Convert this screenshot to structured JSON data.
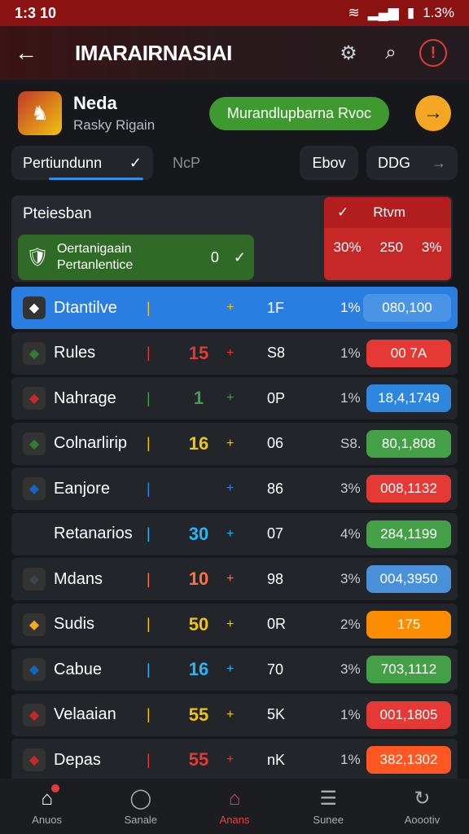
{
  "status": {
    "time": "1:3 10",
    "battery": "1.3%"
  },
  "appbar": {
    "title": "IMARAIRNASIAI",
    "back_icon": "arrow-left-icon",
    "settings_icon": "gear-icon",
    "search_icon": "search-icon",
    "alert_icon": "alert-icon"
  },
  "team": {
    "name": "Neda",
    "subtitle": "Rasky Rigain",
    "action_label": "Murandlupbarna Rvoc"
  },
  "tabs": [
    {
      "label": "Pertiundunn",
      "active": true
    },
    {
      "label": "NcP",
      "active": false
    },
    {
      "label": "Ebov",
      "active": false
    },
    {
      "label": "DDG",
      "active": false
    }
  ],
  "summary": {
    "label": "Pteiesban",
    "green_line1": "Oertanigaain",
    "green_line2": "Pertanlentice",
    "green_value": "0",
    "red_header": "Rtvm",
    "red_values": [
      "30%",
      "250",
      "3%"
    ]
  },
  "rows": [
    {
      "name": "Dtantilve",
      "score": "",
      "mid": "1F",
      "pct": "1%",
      "pill": "080,100",
      "score_color": "#f1c40f",
      "pill_color": "#4a94e6",
      "highlight": true,
      "icon_color": "#ffffff"
    },
    {
      "name": "Rules",
      "score": "15",
      "mid": "S8",
      "pct": "1%",
      "pill": "00  7A",
      "score_color": "#e53935",
      "pill_color": "#e53935",
      "highlight": false,
      "icon_color": "#2e7d32"
    },
    {
      "name": "Nahrage",
      "score": "1",
      "mid": "0P",
      "pct": "1%",
      "pill": "18,4,1749",
      "score_color": "#43a047",
      "pill_color": "#2e86de",
      "highlight": false,
      "icon_color": "#c62828"
    },
    {
      "name": "Colnarlirip",
      "score": "16",
      "mid": "06",
      "pct": "S8.",
      "pill": "80,1,808",
      "score_color": "#f1c40f",
      "pill_color": "#43a047",
      "highlight": false,
      "icon_color": "#2e7d32"
    },
    {
      "name": "Eanjore",
      "score": "",
      "mid": "86",
      "pct": "3%",
      "pill": "008,1132",
      "score_color": "#2e86de",
      "pill_color": "#e53935",
      "highlight": false,
      "icon_color": "#1565c0"
    },
    {
      "name": "Retanarios",
      "score": "30",
      "mid": "07",
      "pct": "4%",
      "pill": "284,1199",
      "score_color": "#29b6f6",
      "pill_color": "#43a047",
      "highlight": false,
      "icon_color": ""
    },
    {
      "name": "Mdans",
      "score": "10",
      "mid": "98",
      "pct": "3%",
      "pill": "004,3950",
      "score_color": "#ff7043",
      "pill_color": "#4a90d9",
      "highlight": false,
      "icon_color": "#37474f"
    },
    {
      "name": "Sudis",
      "score": "50",
      "mid": "0R",
      "pct": "2%",
      "pill": "175",
      "score_color": "#f1c40f",
      "pill_color": "#fb8c00",
      "highlight": false,
      "icon_color": "#f9a825"
    },
    {
      "name": "Cabue",
      "score": "16",
      "mid": "70",
      "pct": "3%",
      "pill": "703,1112",
      "score_color": "#29b6f6",
      "pill_color": "#43a047",
      "highlight": false,
      "icon_color": "#1565c0"
    },
    {
      "name": "Velaaian",
      "score": "55",
      "mid": "5K",
      "pct": "1%",
      "pill": "001,1805",
      "score_color": "#f1c40f",
      "pill_color": "#e53935",
      "highlight": false,
      "icon_color": "#c62828"
    },
    {
      "name": "Depas",
      "score": "55",
      "mid": "nK",
      "pct": "1%",
      "pill": "382,1302",
      "score_color": "#e53935",
      "pill_color": "#ff5722",
      "highlight": false,
      "icon_color": "#c62828"
    }
  ],
  "nav": [
    {
      "label": "Anuos",
      "icon": "home-icon",
      "glyph": "⌂",
      "active": false
    },
    {
      "label": "Sanale",
      "icon": "chat-icon",
      "glyph": "◯",
      "active": false
    },
    {
      "label": "Anans",
      "icon": "stadium-icon",
      "glyph": "⌂",
      "active": true
    },
    {
      "label": "Sunee",
      "icon": "list-icon",
      "glyph": "☰",
      "active": false
    },
    {
      "label": "Aoootiv",
      "icon": "sync-icon",
      "glyph": "↻",
      "active": false
    }
  ]
}
